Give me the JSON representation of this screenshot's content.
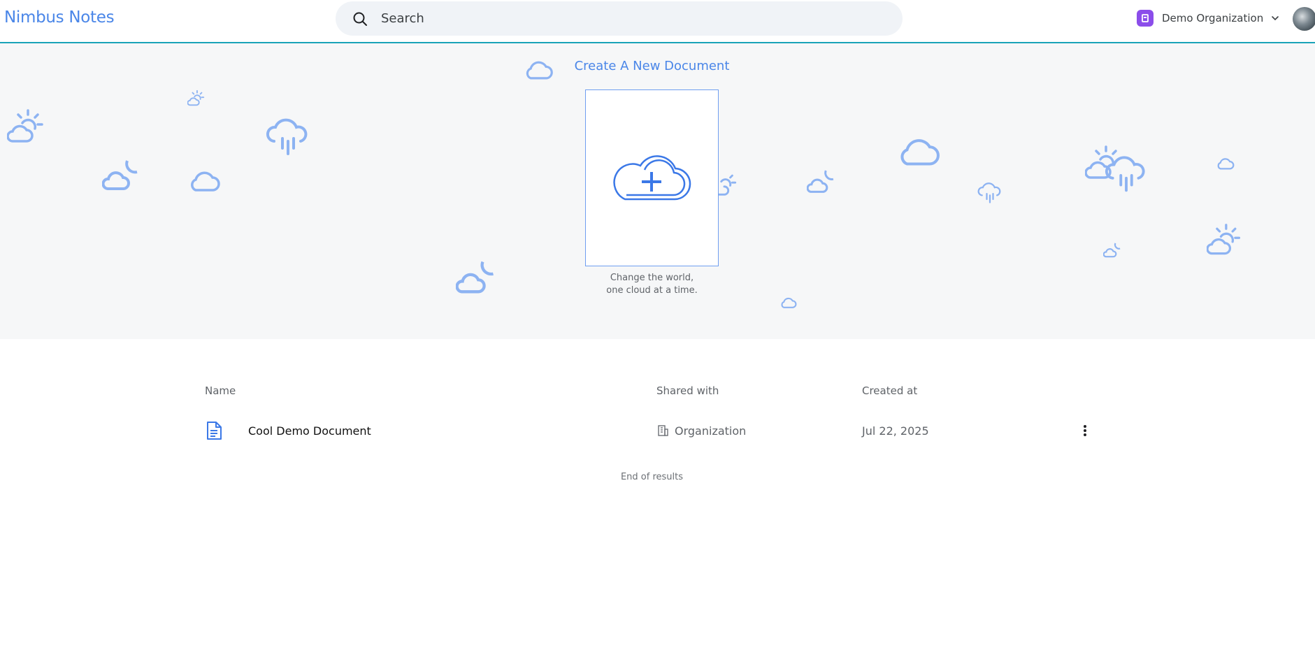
{
  "app": {
    "title": "Nimbus Notes"
  },
  "search": {
    "placeholder": "Search",
    "value": ""
  },
  "org": {
    "name": "Demo Organization",
    "badge_color": "#8b4dea"
  },
  "hero": {
    "title": "Create A New Document",
    "tagline_line1": "Change the world,",
    "tagline_line2": "one cloud at a time."
  },
  "table": {
    "columns": {
      "name": "Name",
      "shared_with": "Shared with",
      "created_at": "Created at"
    },
    "rows": [
      {
        "name": "Cool Demo Document",
        "shared_with": "Organization",
        "created_at": "Jul 22, 2025"
      }
    ],
    "end_text": "End of results"
  },
  "colors": {
    "accent": "#4a86e8",
    "header_rule": "#1aa3b8",
    "hero_bg": "#f6f7f8",
    "icon_light": "#8db3f2"
  },
  "icons": [
    "search-icon",
    "organization-icon",
    "chevron-down-icon",
    "avatar",
    "cloud-plus-icon",
    "document-icon",
    "building-icon",
    "more-vertical-icon",
    "cloud-icon",
    "cloud-moon-icon",
    "cloud-sun-icon",
    "cloud-rain-icon"
  ]
}
